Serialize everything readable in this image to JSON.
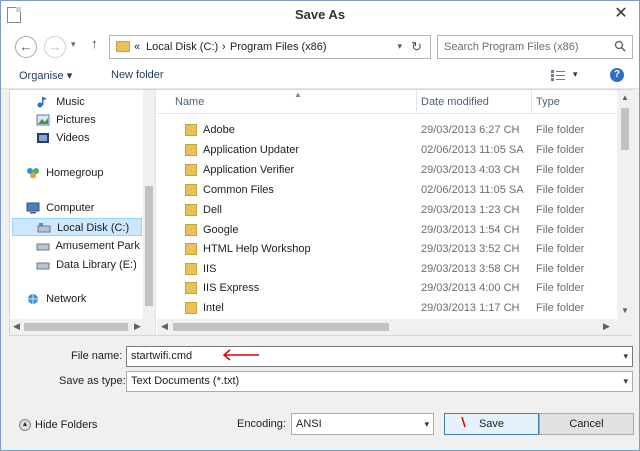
{
  "window": {
    "title": "Save As",
    "close_glyph": "✕"
  },
  "nav": {
    "back_glyph": "←",
    "forward_glyph": "→",
    "recent_glyph": "▾",
    "up_glyph": "↑",
    "address": {
      "prefix": "«",
      "segments": [
        "Local Disk (C:)",
        "Program Files (x86)"
      ],
      "separator": "›"
    },
    "refresh_glyph": "↻",
    "search_placeholder": "Search Program Files (x86)"
  },
  "toolbar": {
    "organise_label": "Organise ▾",
    "new_folder_label": "New folder",
    "help_glyph": "?"
  },
  "sidebar": {
    "items": [
      {
        "label": "Music",
        "icon": "music-icon"
      },
      {
        "label": "Pictures",
        "icon": "pictures-icon"
      },
      {
        "label": "Videos",
        "icon": "videos-icon"
      },
      {
        "label": "Homegroup",
        "icon": "homegroup-icon"
      },
      {
        "label": "Computer",
        "icon": "computer-icon"
      },
      {
        "label": "Local Disk (C:)",
        "icon": "drive-icon",
        "selected": true
      },
      {
        "label": "Amusement Park (I",
        "icon": "drive-icon"
      },
      {
        "label": "Data Library (E:)",
        "icon": "drive-icon"
      },
      {
        "label": "Network",
        "icon": "network-icon"
      }
    ]
  },
  "filelist": {
    "columns": {
      "name": "Name",
      "date": "Date modified",
      "type": "Type"
    },
    "rows": [
      {
        "name": "Adobe",
        "date": "29/03/2013 6:27 CH",
        "type": "File folder"
      },
      {
        "name": "Application Updater",
        "date": "02/06/2013 11:05 SA",
        "type": "File folder"
      },
      {
        "name": "Application Verifier",
        "date": "29/03/2013 4:03 CH",
        "type": "File folder"
      },
      {
        "name": "Common Files",
        "date": "02/06/2013 11:05 SA",
        "type": "File folder"
      },
      {
        "name": "Dell",
        "date": "29/03/2013 1:23 CH",
        "type": "File folder"
      },
      {
        "name": "Google",
        "date": "29/03/2013 1:54 CH",
        "type": "File folder"
      },
      {
        "name": "HTML Help Workshop",
        "date": "29/03/2013 3:52 CH",
        "type": "File folder"
      },
      {
        "name": "IIS",
        "date": "29/03/2013 3:58 CH",
        "type": "File folder"
      },
      {
        "name": "IIS Express",
        "date": "29/03/2013 4:00 CH",
        "type": "File folder"
      },
      {
        "name": "Intel",
        "date": "29/03/2013 1:17 CH",
        "type": "File folder"
      }
    ]
  },
  "form": {
    "filename_label": "File name:",
    "filename_value": "startwifi.cmd",
    "savetype_label": "Save as type:",
    "savetype_value": "Text Documents (*.txt)"
  },
  "bottom": {
    "hide_folders_label": "Hide Folders",
    "encoding_label": "Encoding:",
    "encoding_value": "ANSI",
    "save_label": "Save",
    "cancel_label": "Cancel"
  },
  "colors": {
    "selection": "#cce8ff",
    "accent": "#2f6ec7",
    "annotation": "#e00000",
    "folder": "#e8c15b"
  }
}
